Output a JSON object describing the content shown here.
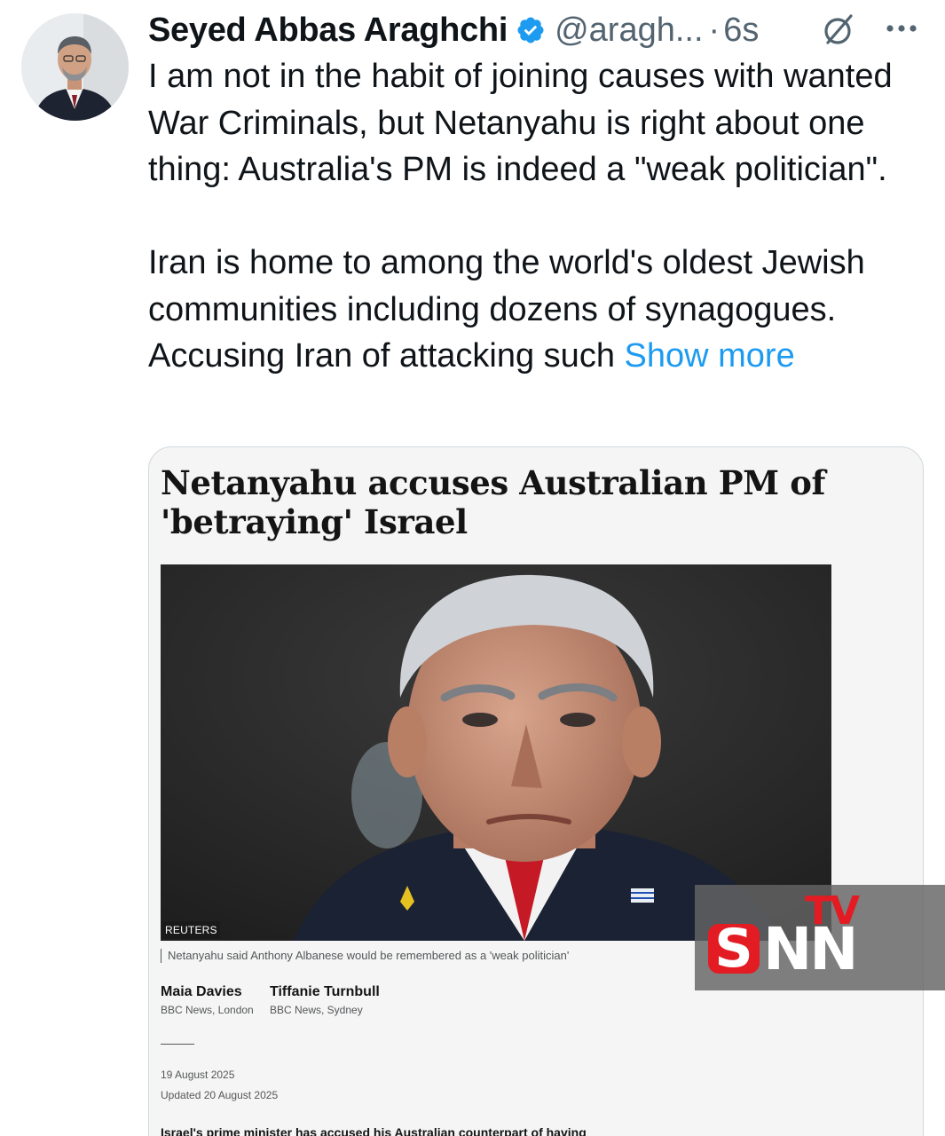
{
  "tweet": {
    "author_name": "Seyed Abbas Araghchi",
    "handle": "@aragh...",
    "separator": "·",
    "time": "6s",
    "verified": true,
    "accent_color": "#1d9bf0",
    "paragraphs": [
      "I am not in the habit of joining causes with wanted War Criminals, but Netanyahu is right about one thing: Australia's PM is indeed a \"weak politician\".",
      "Iran is home to among the world's oldest Jewish communities including dozens of synagogues. Accusing Iran of attacking such"
    ],
    "show_more_label": "Show more",
    "icons": {
      "verified": "verified-badge-icon",
      "grok": "grok-icon",
      "more": "more-options-icon"
    }
  },
  "article": {
    "headline": "Netanyahu accuses Australian PM of 'betraying' Israel",
    "photo_credit": "REUTERS",
    "caption": "Netanyahu said Anthony Albanese would be remembered as a 'weak politician'",
    "authors": [
      {
        "name": "Maia Davies",
        "org": "BBC News, London"
      },
      {
        "name": "Tiffanie Turnbull",
        "org": "BBC News, Sydney"
      }
    ],
    "published": "19 August 2025",
    "updated": "Updated 20 August 2025",
    "lede": "Israel's prime minister has accused his Australian counterpart of having"
  },
  "watermark": {
    "tv": "TV",
    "s": "S",
    "nn": "NN"
  }
}
